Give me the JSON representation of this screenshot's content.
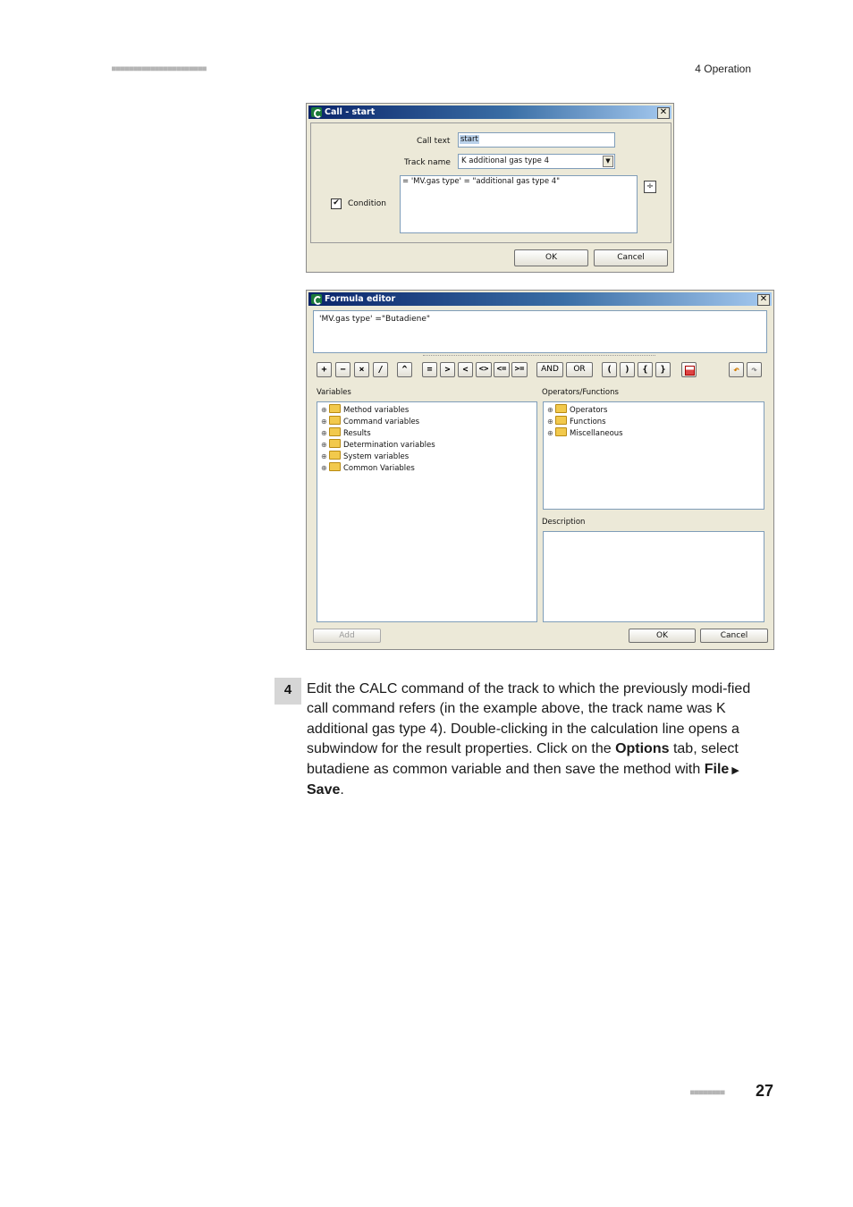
{
  "header": {
    "dots": "■■■■■■■■■■■■■■■■■■■■■■",
    "section": "4 Operation"
  },
  "call_dialog": {
    "title": "Call - start",
    "call_text_label": "Call text",
    "call_text_value": "start",
    "track_name_label": "Track name",
    "track_name_value": "K additional gas type 4",
    "condition_label": "Condition",
    "condition_checked": true,
    "condition_value": "= 'MV.gas type' = \"additional gas type 4\"",
    "ok": "OK",
    "cancel": "Cancel"
  },
  "formula_editor": {
    "title": "Formula editor",
    "formula": "'MV.gas type' =\"Butadiene\"",
    "operators": [
      "+",
      "−",
      "×",
      "/",
      "^",
      "=",
      ">",
      "<",
      "<>",
      "<=",
      ">=",
      "AND",
      "OR",
      "(",
      ")",
      "{",
      "}"
    ],
    "variables_label": "Variables",
    "variables": [
      "Method variables",
      "Command variables",
      "Results",
      "Determination variables",
      "System variables",
      "Common Variables"
    ],
    "operators_functions_label": "Operators/Functions",
    "operators_functions": [
      "Operators",
      "Functions",
      "Miscellaneous"
    ],
    "description_label": "Description",
    "add": "Add",
    "ok": "OK",
    "cancel": "Cancel"
  },
  "step": {
    "number": "4",
    "text_1": "Edit the CALC command of the track to which the previously modi-fied call command refers (in the example above, the track name was K additional gas type 4). Double-clicking in the calculation line opens a subwindow for the result properties. Click on the ",
    "options": "Options",
    "text_2": " tab, select butadiene as common variable and then save the method with ",
    "file": "File",
    "arrow": " ▶ ",
    "save": "Save",
    "end": "."
  },
  "footer": {
    "dots": "■■■■■■■■",
    "page": "27"
  }
}
